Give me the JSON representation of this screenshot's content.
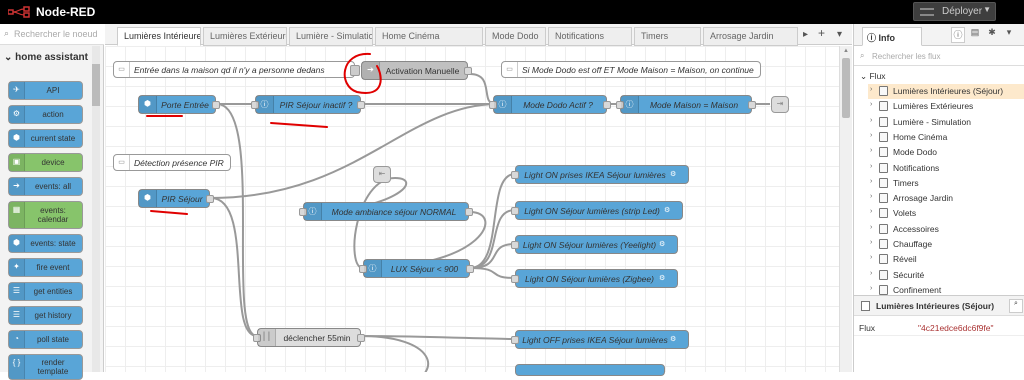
{
  "app": {
    "title": "Node-RED",
    "deploy_label": "Déployer"
  },
  "palette": {
    "search_placeholder": "Rechercher le noeud",
    "category": "home assistant",
    "nodes": [
      {
        "label": "API",
        "icon": "send-icon",
        "color": "#59a5d7"
      },
      {
        "label": "action",
        "icon": "action-icon",
        "color": "#59a5d7"
      },
      {
        "label": "current state",
        "icon": "home-assistant-icon",
        "color": "#59a5d7"
      },
      {
        "label": "device",
        "icon": "device-icon",
        "color": "#87c46b"
      },
      {
        "label": "events: all",
        "icon": "arrow-right-icon",
        "color": "#59a5d7"
      },
      {
        "label": "events: calendar",
        "icon": "calendar-icon",
        "color": "#87c46b"
      },
      {
        "label": "events: state",
        "icon": "home-assistant-icon",
        "color": "#59a5d7"
      },
      {
        "label": "fire event",
        "icon": "fire-event-icon",
        "color": "#59a5d7"
      },
      {
        "label": "get entities",
        "icon": "entities-icon",
        "color": "#59a5d7"
      },
      {
        "label": "get history",
        "icon": "history-icon",
        "color": "#59a5d7"
      },
      {
        "label": "poll state",
        "icon": "timer-icon",
        "color": "#59a5d7"
      },
      {
        "label": "render template",
        "icon": "braces-icon",
        "color": "#59a5d7"
      }
    ]
  },
  "tabs": [
    "Lumières Intérieures",
    "Lumières Extérieures",
    "Lumière - Simulation",
    "Home Cinéma",
    "Mode Dodo",
    "Notifications",
    "Timers",
    "Arrosage Jardin"
  ],
  "flow": {
    "comments": [
      "Entrée dans la maison qd il n'y a personne dedans",
      "Si Mode Dodo est off ET Mode Maison = Maison, on continue",
      "Détection présence PIR"
    ],
    "nodes": {
      "activation_manuelle": "Activation Manuelle",
      "porte_entree": "Porte Entrée",
      "pir_inactif": "PIR Séjour inactif ?",
      "mode_dodo_actif": "Mode Dodo Actif ?",
      "mode_maison": "Mode Maison = Maison",
      "pir_sejour": "PIR Séjour",
      "mode_ambiance": "Mode ambiance séjour NORMAL",
      "lux_sejour": "LUX Séjour < 900",
      "light_on_ikea": "Light ON prises IKEA Séjour lumières",
      "light_on_strip": "Light ON Séjour lumières (strip Led)",
      "light_on_yeelight": "Light ON Séjour lumières (Yeelight)",
      "light_on_zigbee": "Light ON Séjour lumières (Zigbee)",
      "declencher": "déclencher 55min",
      "light_off_ikea": "Light OFF prises IKEA Séjour lumières"
    }
  },
  "sidebar": {
    "tab_label": "Info",
    "search_placeholder": "Rechercher les flux",
    "section": "Flux",
    "flows": [
      "Lumières Intérieures (Séjour)",
      "Lumières Extérieures",
      "Lumière - Simulation",
      "Home Cinéma",
      "Mode Dodo",
      "Notifications",
      "Timers",
      "Arrosage Jardin",
      "Volets",
      "Accessoires",
      "Chauffage",
      "Réveil",
      "Sécurité",
      "Confinement"
    ],
    "info_title": "Lumières Intérieures (Séjour)",
    "info_key": "Flux",
    "info_value": "\"4c21edce6dc6f9fe\""
  },
  "colors": {
    "node_blue": "#59a5d7",
    "node_green": "#87c46b",
    "annotation_red": "#e00000",
    "selected_flow": "#fde9cc"
  }
}
